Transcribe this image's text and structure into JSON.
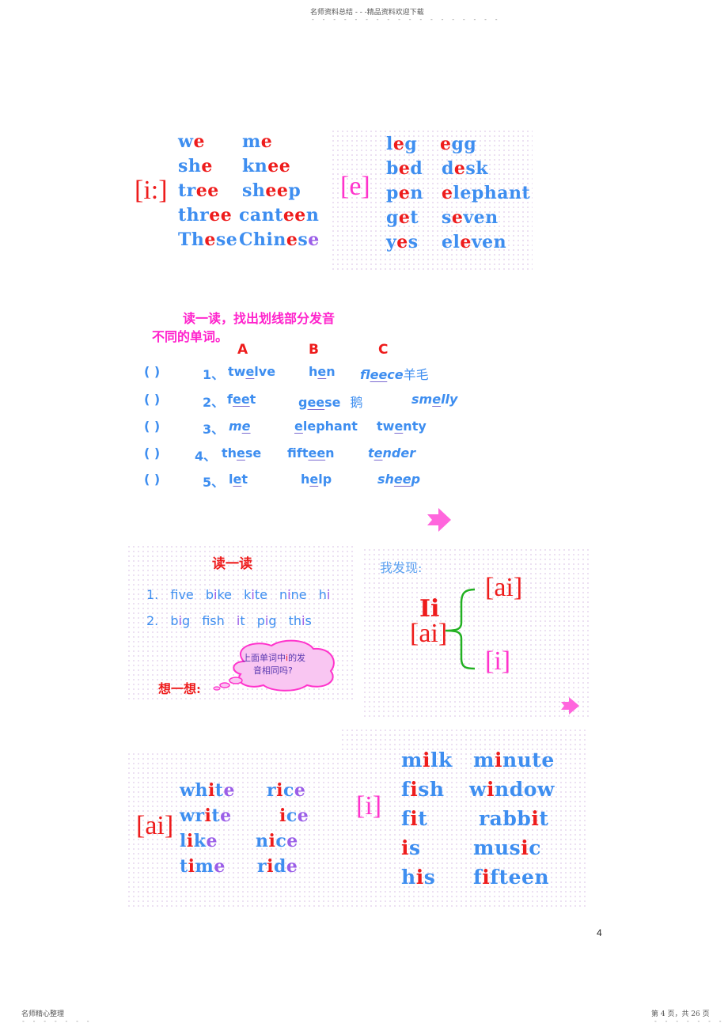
{
  "header": {
    "top_text": "名师资料总结 - - -精品资料欢迎下载",
    "footer_left": "名师精心整理",
    "footer_right": "第 4 页，共 26 页",
    "page_number": "4"
  },
  "panel_i_long": {
    "ipa": "[i:]",
    "words": [
      [
        {
          "t": "w",
          "c": "blue"
        },
        {
          "t": "e",
          "c": "red"
        }
      ],
      [
        {
          "t": "sh",
          "c": "blue"
        },
        {
          "t": "e",
          "c": "red"
        }
      ],
      [
        {
          "t": "tr",
          "c": "blue"
        },
        {
          "t": "ee",
          "c": "red"
        }
      ],
      [
        {
          "t": "thr",
          "c": "blue"
        },
        {
          "t": "ee",
          "c": "red"
        }
      ],
      [
        {
          "t": "Th",
          "c": "blue"
        },
        {
          "t": "e",
          "c": "red"
        },
        {
          "t": "se",
          "c": "blue"
        }
      ],
      [
        {
          "t": "m",
          "c": "blue"
        },
        {
          "t": "e",
          "c": "red"
        }
      ],
      [
        {
          "t": "kn",
          "c": "blue"
        },
        {
          "t": "ee",
          "c": "red"
        }
      ],
      [
        {
          "t": "sh",
          "c": "blue"
        },
        {
          "t": "ee",
          "c": "red"
        },
        {
          "t": "p",
          "c": "blue"
        }
      ],
      [
        {
          "t": "cant",
          "c": "blue"
        },
        {
          "t": "ee",
          "c": "red"
        },
        {
          "t": "n",
          "c": "blue"
        }
      ],
      [
        {
          "t": "Chin",
          "c": "blue"
        },
        {
          "t": "e",
          "c": "red"
        },
        {
          "t": "s",
          "c": "blue"
        },
        {
          "t": "e",
          "c": "purple"
        }
      ]
    ]
  },
  "panel_e": {
    "ipa": "[e]",
    "words": [
      [
        {
          "t": "l",
          "c": "blue"
        },
        {
          "t": "e",
          "c": "red"
        },
        {
          "t": "g",
          "c": "blue"
        }
      ],
      [
        {
          "t": "b",
          "c": "blue"
        },
        {
          "t": "e",
          "c": "red"
        },
        {
          "t": "d",
          "c": "blue"
        }
      ],
      [
        {
          "t": "p",
          "c": "blue"
        },
        {
          "t": "e",
          "c": "red"
        },
        {
          "t": "n",
          "c": "blue"
        }
      ],
      [
        {
          "t": "g",
          "c": "blue"
        },
        {
          "t": "e",
          "c": "red"
        },
        {
          "t": "t",
          "c": "blue"
        }
      ],
      [
        {
          "t": "y",
          "c": "blue"
        },
        {
          "t": "e",
          "c": "red"
        },
        {
          "t": "s",
          "c": "blue"
        }
      ],
      [
        {
          "t": "e",
          "c": "red"
        },
        {
          "t": "gg",
          "c": "blue"
        }
      ],
      [
        {
          "t": "d",
          "c": "blue"
        },
        {
          "t": "e",
          "c": "red"
        },
        {
          "t": "sk",
          "c": "blue"
        }
      ],
      [
        {
          "t": "e",
          "c": "red"
        },
        {
          "t": "lephant",
          "c": "blue"
        }
      ],
      [
        {
          "t": "s",
          "c": "blue"
        },
        {
          "t": "e",
          "c": "red"
        },
        {
          "t": "ven",
          "c": "blue"
        }
      ],
      [
        {
          "t": "el",
          "c": "blue"
        },
        {
          "t": "e",
          "c": "red"
        },
        {
          "t": "ven",
          "c": "blue"
        }
      ]
    ]
  },
  "exercise": {
    "instruction_line1": "读一读，找出划线部分发音",
    "instruction_line2": "不同的单词。",
    "col_labels": [
      "A",
      "B",
      "C"
    ],
    "rows": [
      {
        "paren": "(        )",
        "num": "1、",
        "a": [
          "tw",
          "e",
          "lve"
        ],
        "b": [
          "h",
          "e",
          "n"
        ],
        "c": [
          "fl",
          "ee",
          "ce"
        ],
        "c_note": "羊毛",
        "a_italic": false,
        "c_italic": true
      },
      {
        "paren": "(        )",
        "num": "2、",
        "a": [
          "f",
          "ee",
          "t"
        ],
        "b": [
          "g",
          "ee",
          "se"
        ],
        "c": [
          "sm",
          "e",
          "lly"
        ],
        "b_note": "鹅",
        "a_italic": false,
        "c_italic": true
      },
      {
        "paren": "(        )",
        "num": "3、",
        "a": [
          "m",
          "e",
          ""
        ],
        "b": [
          "",
          "e",
          "lephant"
        ],
        "c": [
          "tw",
          "e",
          "nty"
        ],
        "a_italic": true,
        "c_italic": false
      },
      {
        "paren": "(       )",
        "num": "4、",
        "a": [
          "th",
          "e",
          "se"
        ],
        "b": [
          "fift",
          "ee",
          "n"
        ],
        "c": [
          "t",
          "e",
          "nder"
        ],
        "a_italic": false,
        "c_italic": true
      },
      {
        "paren": "(        )",
        "num": "5、",
        "a": [
          "l",
          "e",
          "t"
        ],
        "b": [
          "h",
          "e",
          "lp"
        ],
        "c": [
          "sh",
          "ee",
          "p"
        ],
        "a_italic": false,
        "c_italic": true
      }
    ]
  },
  "read_panel": {
    "title": "读一读",
    "row1": {
      "num": "1.",
      "words": [
        [
          "f",
          "i",
          "ve"
        ],
        [
          "b",
          "i",
          "ke"
        ],
        [
          "k",
          "i",
          "te"
        ],
        [
          "n",
          "i",
          "ne"
        ],
        [
          "h",
          "i",
          ""
        ]
      ]
    },
    "row2": {
      "num": "2.",
      "words": [
        [
          "b",
          "i",
          "g"
        ],
        [
          "f",
          "i",
          "sh"
        ],
        [
          "",
          "i",
          "t"
        ],
        [
          "p",
          "i",
          "g"
        ],
        [
          "th",
          "i",
          "s"
        ]
      ]
    },
    "think_label": "想一想:",
    "bubble_line1_pre": "上面单词中",
    "bubble_line1_hl": "i",
    "bubble_line1_post": "的发",
    "bubble_line2": "音相同吗?"
  },
  "discover_panel": {
    "title": "我发现:",
    "letter": "Ii",
    "letter_ipa": "[ai]",
    "branch_top": "[ai]",
    "branch_bottom": "[i]"
  },
  "panel_ai": {
    "ipa": "[ai]",
    "words": [
      [
        {
          "t": "wh",
          "c": "blue"
        },
        {
          "t": "i",
          "c": "red"
        },
        {
          "t": "t",
          "c": "blue"
        },
        {
          "t": "e",
          "c": "purple"
        }
      ],
      [
        {
          "t": "wr",
          "c": "blue"
        },
        {
          "t": "i",
          "c": "red"
        },
        {
          "t": "t",
          "c": "blue"
        },
        {
          "t": "e",
          "c": "purple"
        }
      ],
      [
        {
          "t": "l",
          "c": "blue"
        },
        {
          "t": "i",
          "c": "red"
        },
        {
          "t": "k",
          "c": "blue"
        },
        {
          "t": "e",
          "c": "purple"
        }
      ],
      [
        {
          "t": "t",
          "c": "blue"
        },
        {
          "t": "i",
          "c": "red"
        },
        {
          "t": "m",
          "c": "blue"
        },
        {
          "t": "e",
          "c": "purple"
        }
      ],
      [
        {
          "t": "r",
          "c": "blue"
        },
        {
          "t": "i",
          "c": "red"
        },
        {
          "t": "c",
          "c": "blue"
        },
        {
          "t": "e",
          "c": "purple"
        }
      ],
      [
        {
          "t": "i",
          "c": "red"
        },
        {
          "t": "c",
          "c": "blue"
        },
        {
          "t": "e",
          "c": "purple"
        }
      ],
      [
        {
          "t": "n",
          "c": "blue"
        },
        {
          "t": "i",
          "c": "red"
        },
        {
          "t": "c",
          "c": "blue"
        },
        {
          "t": "e",
          "c": "purple"
        }
      ],
      [
        {
          "t": "r",
          "c": "blue"
        },
        {
          "t": "i",
          "c": "red"
        },
        {
          "t": "d",
          "c": "blue"
        },
        {
          "t": "e",
          "c": "purple"
        }
      ]
    ]
  },
  "panel_i_short": {
    "ipa": "[i]",
    "words": [
      [
        {
          "t": "m",
          "c": "blue"
        },
        {
          "t": "i",
          "c": "red"
        },
        {
          "t": "lk",
          "c": "blue"
        }
      ],
      [
        {
          "t": "f",
          "c": "blue"
        },
        {
          "t": "i",
          "c": "red"
        },
        {
          "t": "sh",
          "c": "blue"
        }
      ],
      [
        {
          "t": "f",
          "c": "blue"
        },
        {
          "t": "i",
          "c": "red"
        },
        {
          "t": "t",
          "c": "blue"
        }
      ],
      [
        {
          "t": "i",
          "c": "red"
        },
        {
          "t": "s",
          "c": "blue"
        }
      ],
      [
        {
          "t": "h",
          "c": "blue"
        },
        {
          "t": "i",
          "c": "red"
        },
        {
          "t": "s",
          "c": "blue"
        }
      ],
      [
        {
          "t": "m",
          "c": "blue"
        },
        {
          "t": "i",
          "c": "red"
        },
        {
          "t": "nute",
          "c": "blue"
        }
      ],
      [
        {
          "t": "w",
          "c": "blue"
        },
        {
          "t": "i",
          "c": "red"
        },
        {
          "t": "ndow",
          "c": "blue"
        }
      ],
      [
        {
          "t": "rabb",
          "c": "blue"
        },
        {
          "t": "i",
          "c": "red"
        },
        {
          "t": "t",
          "c": "blue"
        }
      ],
      [
        {
          "t": "mus",
          "c": "blue"
        },
        {
          "t": "i",
          "c": "red"
        },
        {
          "t": "c",
          "c": "blue"
        }
      ],
      [
        {
          "t": "f",
          "c": "blue"
        },
        {
          "t": "i",
          "c": "red"
        },
        {
          "t": "fteen",
          "c": "blue"
        }
      ]
    ]
  },
  "colors": {
    "blue": "#3e8ef0",
    "red": "#ee1c1c",
    "purple": "#9b5ee8",
    "magenta": "#ff22cc",
    "green": "#22b022",
    "arrow_pink": "#ff66dd"
  }
}
